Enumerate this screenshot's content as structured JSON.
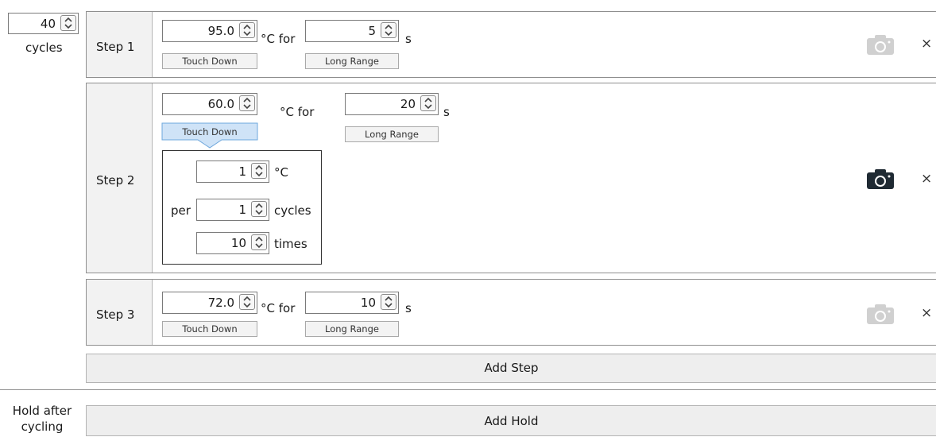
{
  "cycles": {
    "value": "40",
    "label": "cycles"
  },
  "steps": [
    {
      "name": "Step 1",
      "temp": "95.0",
      "temp_unit": "°C for",
      "time": "5",
      "time_unit": "s",
      "touch_down": "Touch Down",
      "long_range": "Long Range",
      "camera_enabled": false,
      "close": "×"
    },
    {
      "name": "Step 2",
      "temp": "60.0",
      "temp_unit": "°C for",
      "time": "20",
      "time_unit": "s",
      "touch_down": "Touch Down",
      "long_range": "Long Range",
      "camera_enabled": true,
      "close": "×",
      "touchdown_settings": {
        "delta": "1",
        "delta_unit": "°C",
        "per_label": "per",
        "per_cycles": "1",
        "cycles_label": "cycles",
        "times": "10",
        "times_label": "times"
      }
    },
    {
      "name": "Step 3",
      "temp": "72.0",
      "temp_unit": "°C for",
      "time": "10",
      "time_unit": "s",
      "touch_down": "Touch Down",
      "long_range": "Long Range",
      "camera_enabled": false,
      "close": "×"
    }
  ],
  "add_step_label": "Add Step",
  "hold": {
    "label": "Hold after cycling",
    "add_hold_label": "Add Hold"
  },
  "colors": {
    "touchdown_active": "#cfe3f7",
    "camera_active": "#1f2a33",
    "camera_inactive": "#d0d0d0"
  }
}
